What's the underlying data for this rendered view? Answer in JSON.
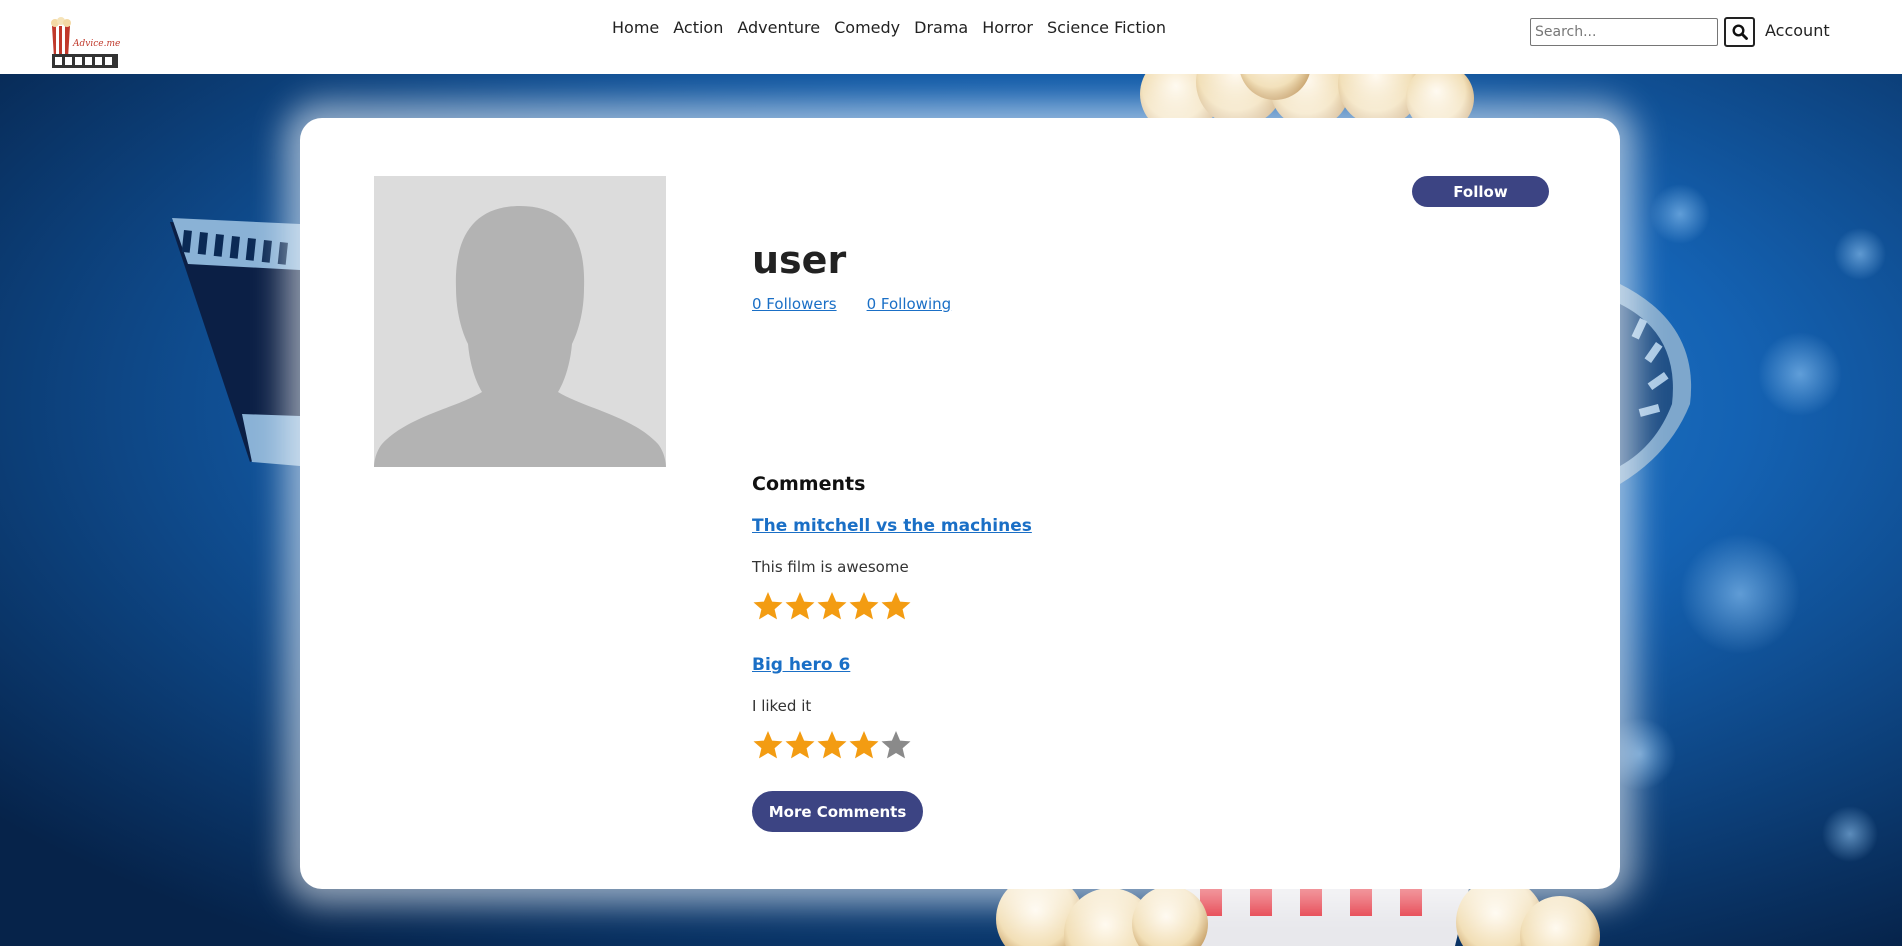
{
  "header": {
    "logo_text": "Advice.me",
    "nav": [
      "Home",
      "Action",
      "Adventure",
      "Comedy",
      "Drama",
      "Horror",
      "Science Fiction"
    ],
    "search_placeholder": "Search...",
    "search_icon": "magnifier-icon",
    "account_label": "Account"
  },
  "profile": {
    "username": "user",
    "followers_label": "0 Followers",
    "following_label": "0 Following",
    "follow_button": "Follow",
    "avatar_icon": "default-avatar-silhouette"
  },
  "comments": {
    "heading": "Comments",
    "items": [
      {
        "movie": "The mitchell vs the machines",
        "text": "This film is awesome",
        "rating": 5,
        "max_rating": 5
      },
      {
        "movie": "Big hero 6",
        "text": "I liked it",
        "rating": 4,
        "max_rating": 5
      }
    ],
    "more_button": "More Comments"
  },
  "colors": {
    "primary_button": "#3c4483",
    "link": "#1a6fc6",
    "star_filled": "#f39c12",
    "star_empty": "#8a8a8a",
    "background_blue": "#1565c0"
  }
}
